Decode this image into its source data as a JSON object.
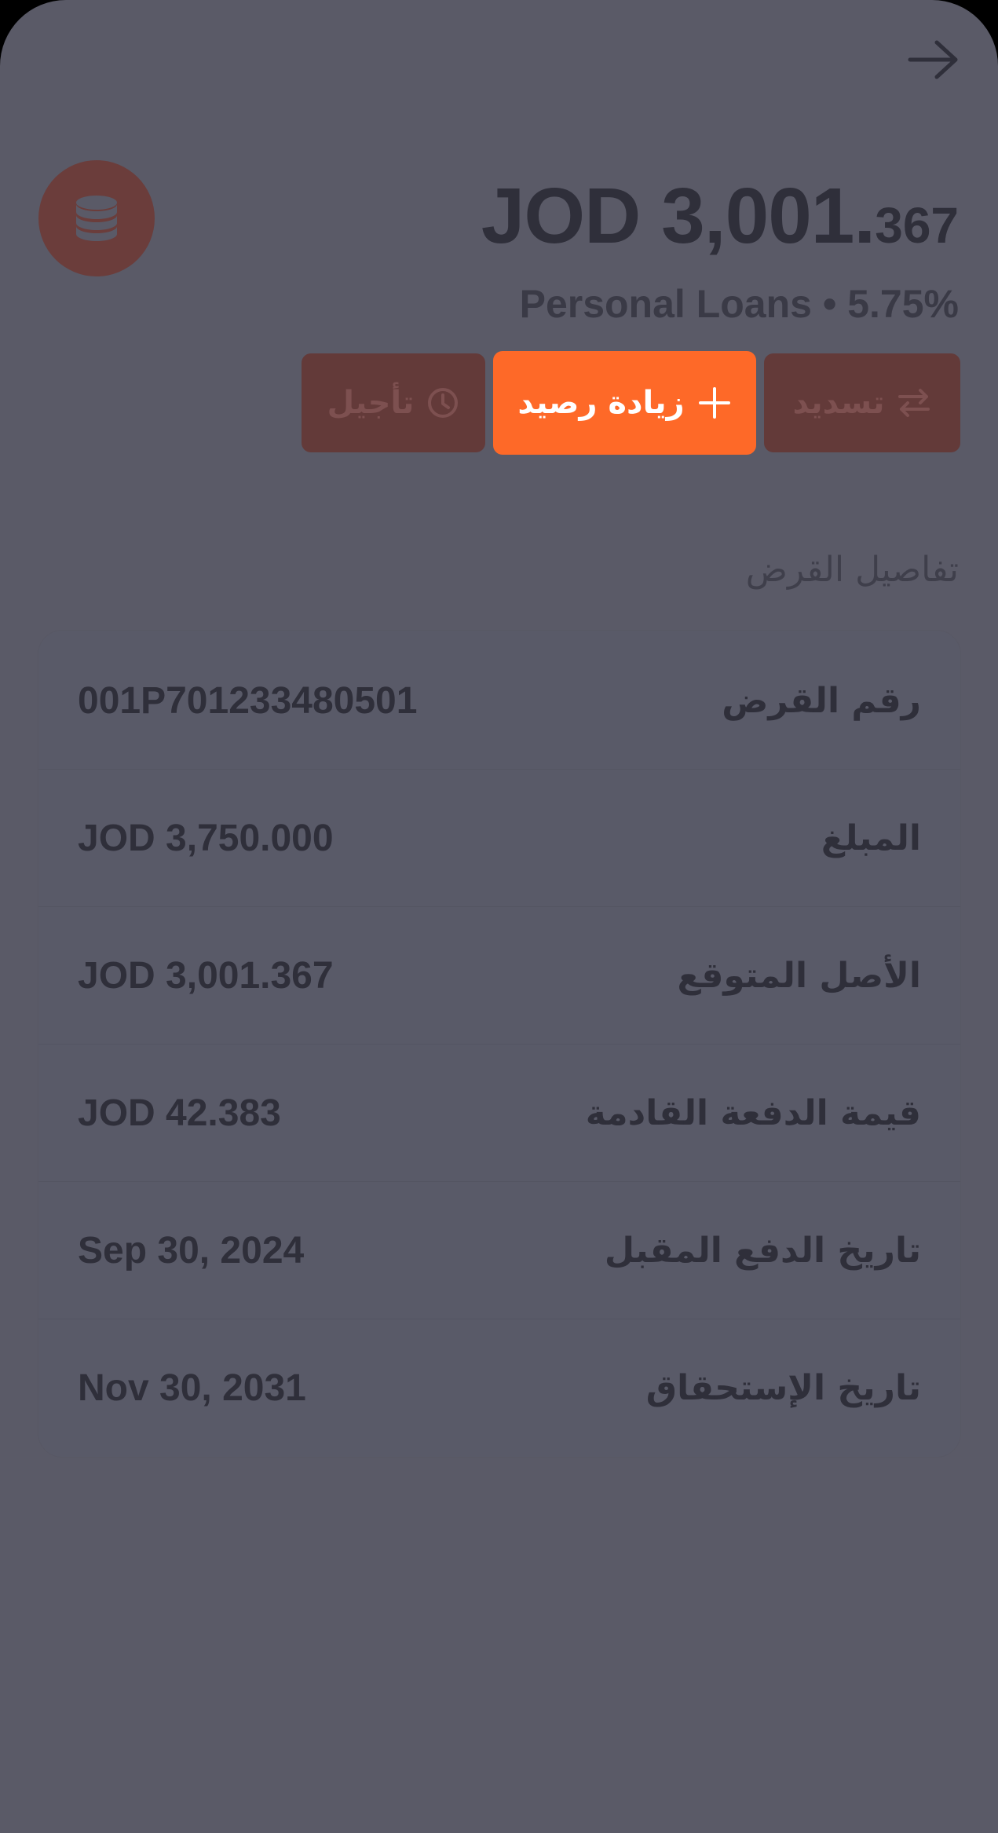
{
  "header": {
    "back_icon": "arrow-right-icon"
  },
  "account": {
    "icon": "coins-stack-icon",
    "balance_major": "JOD 3,001.",
    "balance_minor": "367",
    "subtitle": "Personal Loans • 5.75%"
  },
  "actions": {
    "repay_label": "تسديد",
    "repay_icon": "swap-arrows-icon",
    "increase_label": "زيادة رصيد",
    "increase_icon": "plus-icon",
    "defer_label": "تأجيل",
    "defer_icon": "clock-icon"
  },
  "details": {
    "title": "تفاصيل القرض",
    "rows": [
      {
        "label": "رقم القرض",
        "value": "001P701233480501"
      },
      {
        "label": "المبلغ",
        "value": "JOD 3,750.000"
      },
      {
        "label": "الأصل المتوقع",
        "value": "JOD 3,001.367"
      },
      {
        "label": "قيمة الدفعة القادمة",
        "value": "JOD 42.383"
      },
      {
        "label": "تاريخ الدفع المقبل",
        "value": "Sep 30, 2024"
      },
      {
        "label": "تاريخ الإستحقاق",
        "value": "Nov 30, 2031"
      }
    ]
  },
  "colors": {
    "overlay_background": "#5a5a67",
    "accent": "#fe6928",
    "dimmed_accent": "#633a39",
    "text_dark": "#2f2f3a"
  }
}
